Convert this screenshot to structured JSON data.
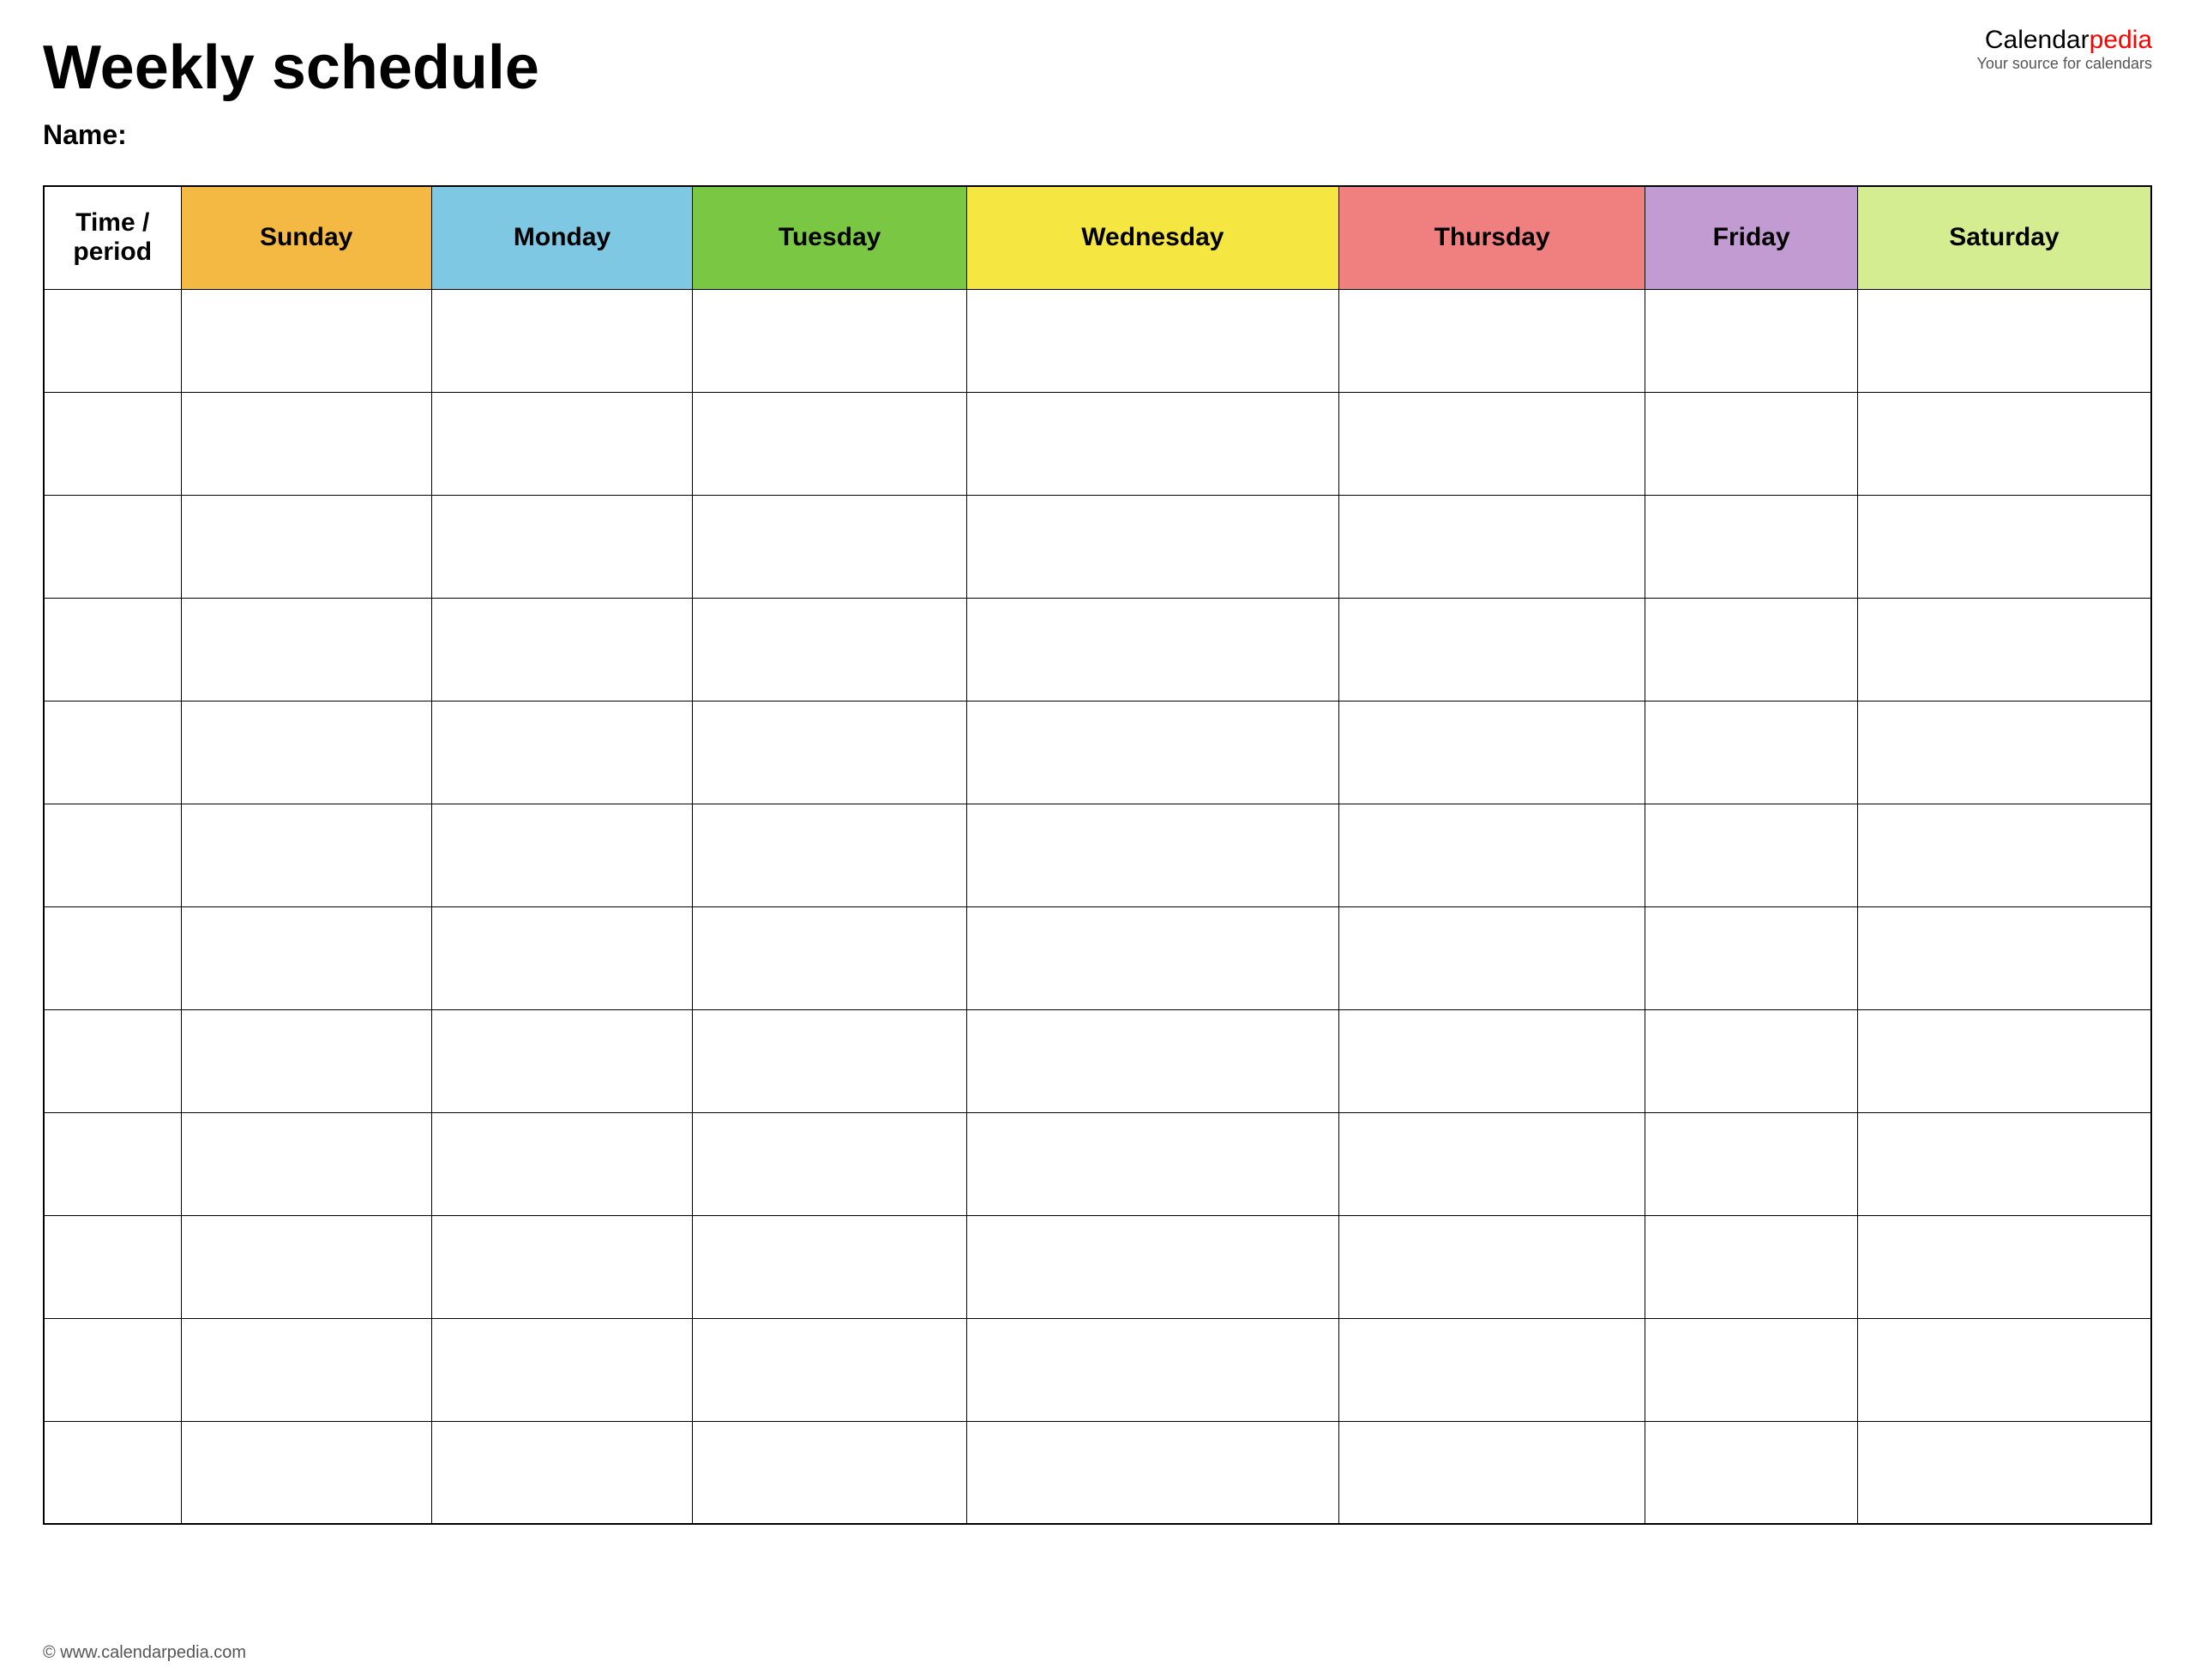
{
  "header": {
    "title": "Weekly schedule",
    "name_label": "Name:",
    "logo_calendar": "Calendar",
    "logo_pedia": "pedia",
    "logo_sub": "Your source for calendars",
    "logo_url": "Calendarpedia"
  },
  "table": {
    "columns": [
      {
        "id": "time",
        "label": "Time / period",
        "class": "th-time"
      },
      {
        "id": "sunday",
        "label": "Sunday",
        "class": "th-sunday"
      },
      {
        "id": "monday",
        "label": "Monday",
        "class": "th-monday"
      },
      {
        "id": "tuesday",
        "label": "Tuesday",
        "class": "th-tuesday"
      },
      {
        "id": "wednesday",
        "label": "Wednesday",
        "class": "th-wednesday"
      },
      {
        "id": "thursday",
        "label": "Thursday",
        "class": "th-thursday"
      },
      {
        "id": "friday",
        "label": "Friday",
        "class": "th-friday"
      },
      {
        "id": "saturday",
        "label": "Saturday",
        "class": "th-saturday"
      }
    ],
    "row_count": 12
  },
  "footer": {
    "url": "© www.calendarpedia.com"
  }
}
